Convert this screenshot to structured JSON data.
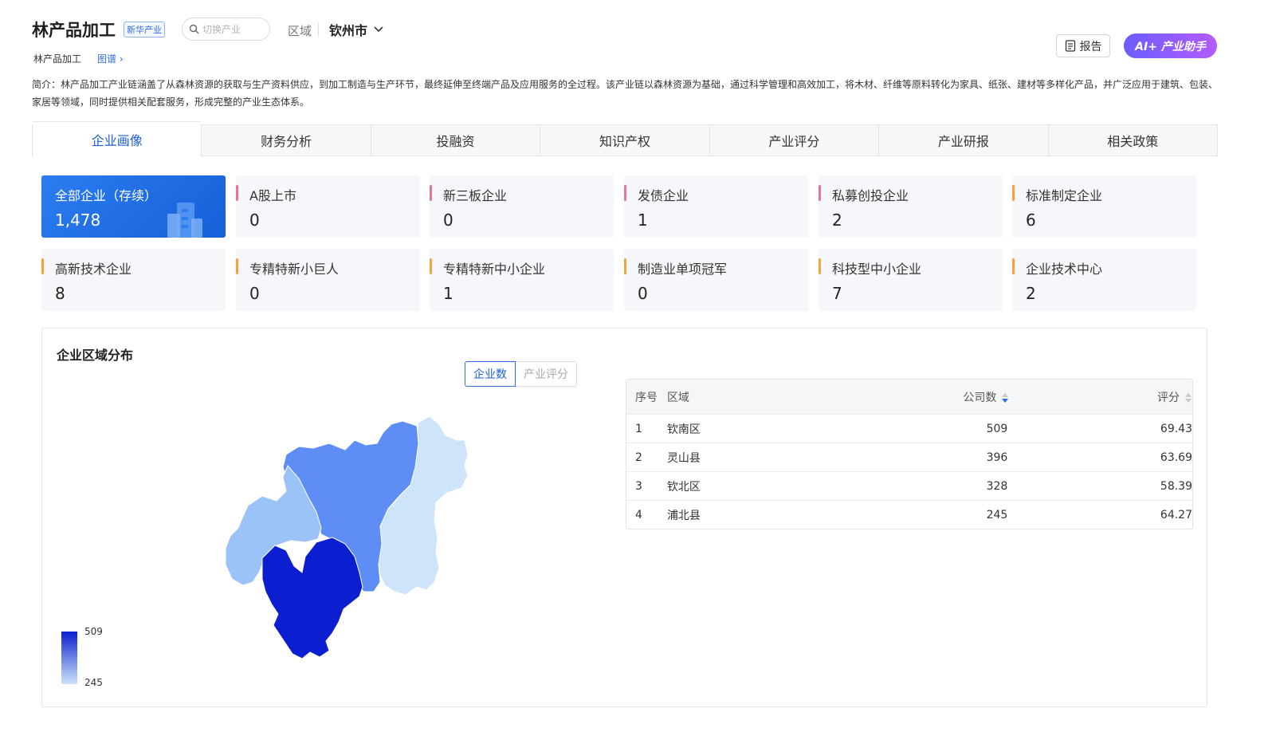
{
  "header": {
    "title": "林产品加工",
    "tag": "新华产业",
    "search_placeholder": "切换产业",
    "region_label": "区域",
    "region_value": "钦州市",
    "breadcrumb": "林产品加工",
    "graph_link": "图谱",
    "report_label": "报告",
    "ai_label": "AI+ 产业助手"
  },
  "intro": "简介：林产品加工产业链涵盖了从森林资源的获取与生产资料供应，到加工制造与生产环节，最终延伸至终端产品及应用服务的全过程。该产业链以森林资源为基础，通过科学管理和高效加工，将木材、纤维等原料转化为家具、纸张、建材等多样化产品，并广泛应用于建筑、包装、家居等领域，同时提供相关配套服务，形成完整的产业生态体系。",
  "tabs": [
    "企业画像",
    "财务分析",
    "投融资",
    "知识产权",
    "产业评分",
    "产业研报",
    "相关政策"
  ],
  "active_tab": "企业画像",
  "stats": [
    {
      "label": "全部企业（存续）",
      "value": "1,478",
      "color": "#1560d8"
    },
    {
      "label": "A股上市",
      "value": "0",
      "color": "#e8739a"
    },
    {
      "label": "新三板企业",
      "value": "0",
      "color": "#e8739a"
    },
    {
      "label": "发债企业",
      "value": "1",
      "color": "#e8739a"
    },
    {
      "label": "私募创投企业",
      "value": "2",
      "color": "#e8739a"
    },
    {
      "label": "标准制定企业",
      "value": "6",
      "color": "#f5a23c"
    },
    {
      "label": "高新技术企业",
      "value": "8",
      "color": "#f5a23c"
    },
    {
      "label": "专精特新小巨人",
      "value": "0",
      "color": "#f5a23c"
    },
    {
      "label": "专精特新中小企业",
      "value": "1",
      "color": "#f5a23c"
    },
    {
      "label": "制造业单项冠军",
      "value": "0",
      "color": "#f5a23c"
    },
    {
      "label": "科技型中小企业",
      "value": "7",
      "color": "#f5a23c"
    },
    {
      "label": "企业技术中心",
      "value": "2",
      "color": "#f5a23c"
    }
  ],
  "region_panel": {
    "title": "企业区域分布",
    "toggle_on": "企业数",
    "toggle_off": "产业评分",
    "legend_max": "509",
    "legend_min": "245",
    "columns": [
      "序号",
      "区域",
      "公司数",
      "评分"
    ],
    "rows": [
      {
        "no": "1",
        "region": "钦南区",
        "count": "509",
        "score": "69.43"
      },
      {
        "no": "2",
        "region": "灵山县",
        "count": "396",
        "score": "63.69"
      },
      {
        "no": "3",
        "region": "钦北区",
        "count": "328",
        "score": "58.39"
      },
      {
        "no": "4",
        "region": "浦北县",
        "count": "245",
        "score": "64.27"
      }
    ],
    "map_colors": {
      "钦南区": "#0b1fd0",
      "灵山县": "#5e8ef5",
      "钦北区": "#9cc3f7",
      "浦北县": "#cde4fb"
    }
  }
}
